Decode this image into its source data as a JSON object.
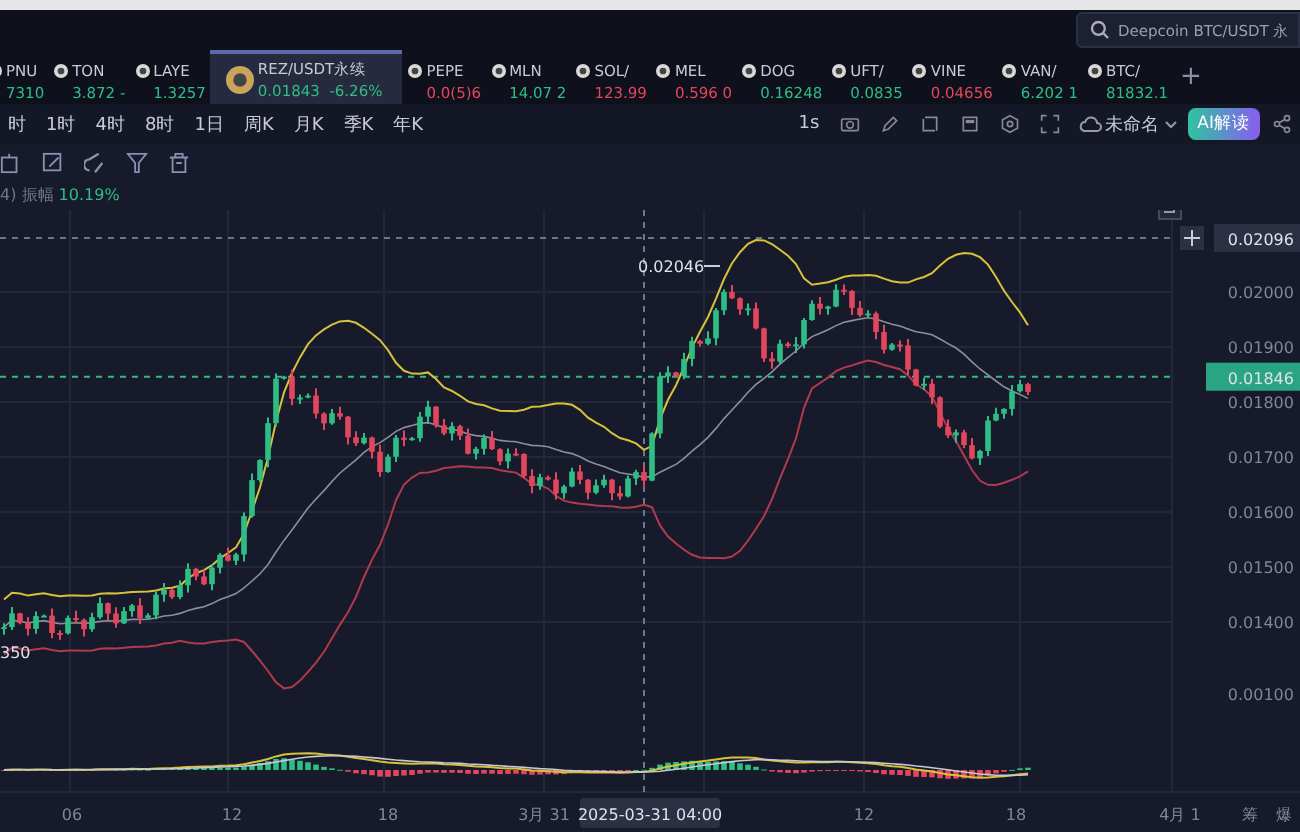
{
  "search": {
    "placeholder": "Deepcoin BTC/USDT 永"
  },
  "tickers": [
    {
      "symbol": "PNU",
      "price": "7310",
      "color": "#2ebd85",
      "selected": false
    },
    {
      "symbol": "TON",
      "price": "3.872 -",
      "color": "#2ebd85",
      "selected": false
    },
    {
      "symbol": "LAYE",
      "price": "1.3257",
      "color": "#2ebd85",
      "selected": false
    },
    {
      "symbol": "REZ/USDT永续",
      "price": "0.01843",
      "change": "-6.26%",
      "color": "#2ebd85",
      "selected": true
    },
    {
      "symbol": "PEPE",
      "price": "0.0(5)6",
      "color": "#e2465c",
      "selected": false
    },
    {
      "symbol": "MLN",
      "price": "14.07 2",
      "color": "#2ebd85",
      "selected": false
    },
    {
      "symbol": "SOL/",
      "price": "123.99",
      "color": "#e2465c",
      "selected": false
    },
    {
      "symbol": "MEL",
      "price": "0.596 0",
      "color": "#e2465c",
      "selected": false
    },
    {
      "symbol": "DOG",
      "price": "0.16248",
      "color": "#2ebd85",
      "selected": false
    },
    {
      "symbol": "UFT/",
      "price": "0.0835",
      "color": "#2ebd85",
      "selected": false
    },
    {
      "symbol": "VINE",
      "price": "0.04656",
      "color": "#e2465c",
      "selected": false
    },
    {
      "symbol": "VAN/",
      "price": "6.202 1",
      "color": "#2ebd85",
      "selected": false
    },
    {
      "symbol": "BTC/",
      "price": "81832.1",
      "color": "#2ebd85",
      "selected": false
    }
  ],
  "add_tab": "+",
  "timeframes": [
    "时",
    "1时",
    "4时",
    "8时",
    "1日",
    "周K",
    "月K",
    "季K",
    "年K"
  ],
  "interval": "1s",
  "layout_name": "未命名",
  "ai_button": "AI解读",
  "legend": {
    "prefix": "4)",
    "label": "振幅",
    "value": "10.19%"
  },
  "price_axis": {
    "labels": [
      "0.02000",
      "0.01900",
      "0.01800",
      "0.01700",
      "0.01600",
      "0.01500",
      "0.01400"
    ],
    "crosshair_price": "0.02096",
    "current_price": "0.01846",
    "macd_label": "0.00100"
  },
  "high_marker": "0.02046",
  "low_marker": "350",
  "time_axis": {
    "labels": [
      "06",
      "12",
      "18",
      "3月 31",
      "12",
      "18",
      "4月 1"
    ],
    "crosshair_time": "2025-03-31 04:00"
  },
  "side_tabs": [
    "筹",
    "爆"
  ]
}
